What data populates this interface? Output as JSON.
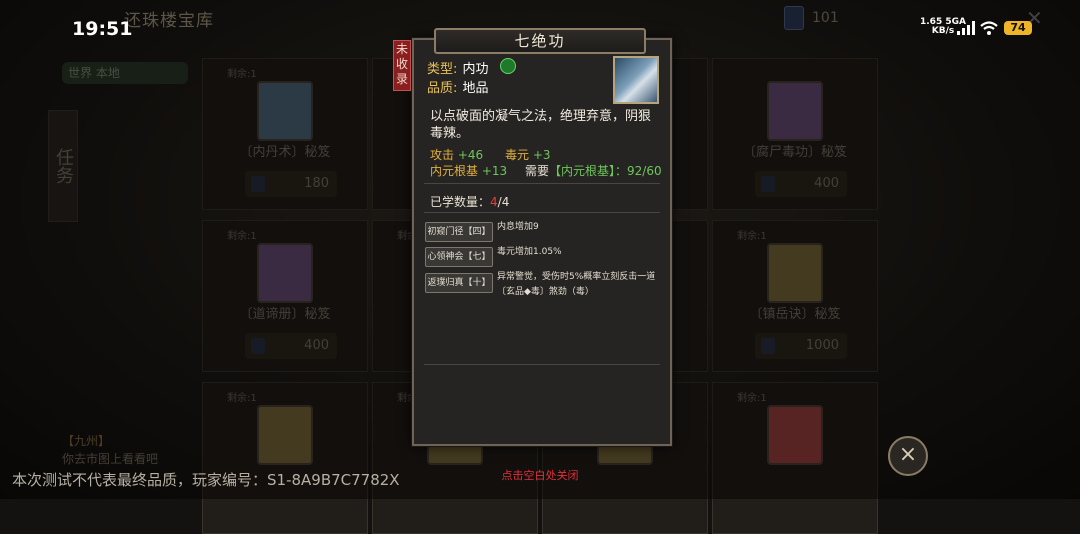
{
  "status_bar": {
    "time": "19:51",
    "net_speed": "1.65 5GA",
    "net_unit": "KB/s",
    "battery": "74"
  },
  "background": {
    "title": "还珠楼宝库",
    "currency_value": "101",
    "side_tab": "任务",
    "world_tabs": "世界  本地",
    "cards": [
      {
        "remaining": "剩余:1",
        "name": "〔内丹术〕秘笈",
        "price": "180",
        "color": "#4f6a7e"
      },
      {
        "remaining": "剩余:1",
        "name": "",
        "price": "",
        "color": "#4a4438"
      },
      {
        "remaining": "",
        "name": "",
        "price": "",
        "color": "#4a4438"
      },
      {
        "remaining": "",
        "name": "〔腐尸毒功〕秘笈",
        "price": "400",
        "color": "#6a4f7a"
      },
      {
        "remaining": "剩余:1",
        "name": "〔道谛册〕秘笈",
        "price": "400",
        "color": "#6a4f7a"
      },
      {
        "remaining": "剩余:1",
        "name": "",
        "price": "",
        "color": "#4a4438"
      },
      {
        "remaining": "",
        "name": "",
        "price": "",
        "color": "#4a4438"
      },
      {
        "remaining": "剩余:1",
        "name": "〔镇岳诀〕秘笈",
        "price": "1000",
        "color": "#7a6a3a"
      },
      {
        "remaining": "剩余:1",
        "name": "",
        "price": "",
        "color": "#7a6a3a"
      },
      {
        "remaining": "剩余:1",
        "name": "",
        "price": "",
        "color": "#7a6a3a"
      },
      {
        "remaining": "",
        "name": "",
        "price": "",
        "color": "#7a6a3a"
      },
      {
        "remaining": "剩余:1",
        "name": "",
        "price": "",
        "color": "#a04040"
      }
    ],
    "chat_line1": "【九州】",
    "chat_line2": "你去市图上看看吧"
  },
  "popup": {
    "title": "七绝功",
    "tag": "未收录",
    "type_label": "类型:",
    "type_value": "内功",
    "quality_label": "品质:",
    "quality_value": "地品",
    "description": "以点破面的凝气之法，绝理弃意，阴狠毒辣。",
    "stats": {
      "attack_label": "攻击",
      "attack_value": "+46",
      "poison_label": "毒元",
      "poison_value": "+3",
      "root_label": "内元根基",
      "root_value": "+13",
      "need_prefix": "需要",
      "need_attr": "【内元根基】",
      "need_value": "：92/60"
    },
    "learned_label": "已学数量：",
    "learned_current": "4",
    "learned_total": "/4",
    "skills": [
      {
        "name": "初窥门径【四】",
        "effect": "内息增加9"
      },
      {
        "name": "心领神会【七】",
        "effect": "毒元增加1.05%"
      },
      {
        "name": "返璞归真【十】",
        "effect": "异常警觉，受伤时5%概率立刻反击一道〔玄品◆毒〕煞劲（毒）"
      }
    ],
    "colors": {
      "label": "#e8c15a",
      "stat_gold": "#e0b040",
      "stat_green": "#6ec65a",
      "learned_red": "#e04040"
    }
  },
  "footer": {
    "disclaimer": "本次测试不代表最终品质，玩家编号：S1-8A9B7C7782X",
    "close_hint": "点击空白处关闭",
    "close_icon": "×"
  }
}
